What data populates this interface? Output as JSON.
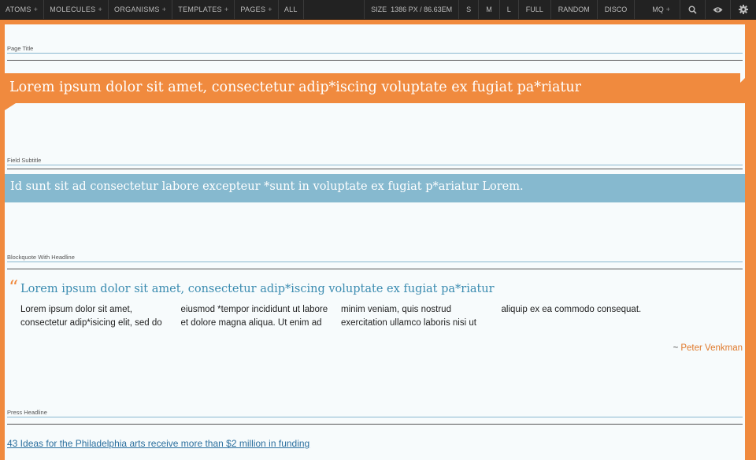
{
  "toolbar": {
    "nav": [
      {
        "label": "ATOMS",
        "caret": "+"
      },
      {
        "label": "MOLECULES",
        "caret": "+"
      },
      {
        "label": "ORGANISMS",
        "caret": "+"
      },
      {
        "label": "TEMPLATES",
        "caret": "+"
      },
      {
        "label": "PAGES",
        "caret": "+"
      },
      {
        "label": "ALL",
        "caret": ""
      }
    ],
    "size_label": "SIZE",
    "size_value": "1386 PX / 86.63EM",
    "size_buttons": [
      "S",
      "M",
      "L",
      "FULL",
      "RANDOM",
      "DISCO"
    ],
    "mq_label": "MQ",
    "mq_caret": "+",
    "icons": [
      "search-icon",
      "eye-icon",
      "gear-icon"
    ]
  },
  "patterns": {
    "page_title": {
      "label": "Page Title",
      "text": "Lorem ipsum dolor sit amet, consectetur adip*iscing voluptate ex fugiat pa*riatur"
    },
    "field_subtitle": {
      "label": "Field Subtitle",
      "text": "Id sunt sit ad consectetur labore excepteur *sunt in voluptate ex fugiat p*ariatur Lorem."
    },
    "blockquote": {
      "label": "Blockquote With Headline",
      "quote_mark": "“",
      "headline": "Lorem ipsum dolor sit amet, consectetur adip*iscing voluptate ex fugiat pa*riatur",
      "body": "Lorem ipsum dolor sit amet, consectetur adip*isicing elit, sed do eiusmod *tempor incididunt ut labore et dolore magna aliqua. Ut enim ad minim veniam, quis nostrud exercitation ullamco laboris nisi ut aliquip ex ea commodo consequat.",
      "cite_prefix": "~",
      "cite_name": "Peter Venkman"
    },
    "press_headline": {
      "label": "Press Headline",
      "link_text": "43 Ideas for the Philadelphia arts receive more than $2 million in funding"
    }
  },
  "colors": {
    "accent_orange": "#f08a3e",
    "subtitle_blue": "#86b9cf",
    "link_blue": "#2b6f9e",
    "toolbar_bg": "#222222"
  }
}
